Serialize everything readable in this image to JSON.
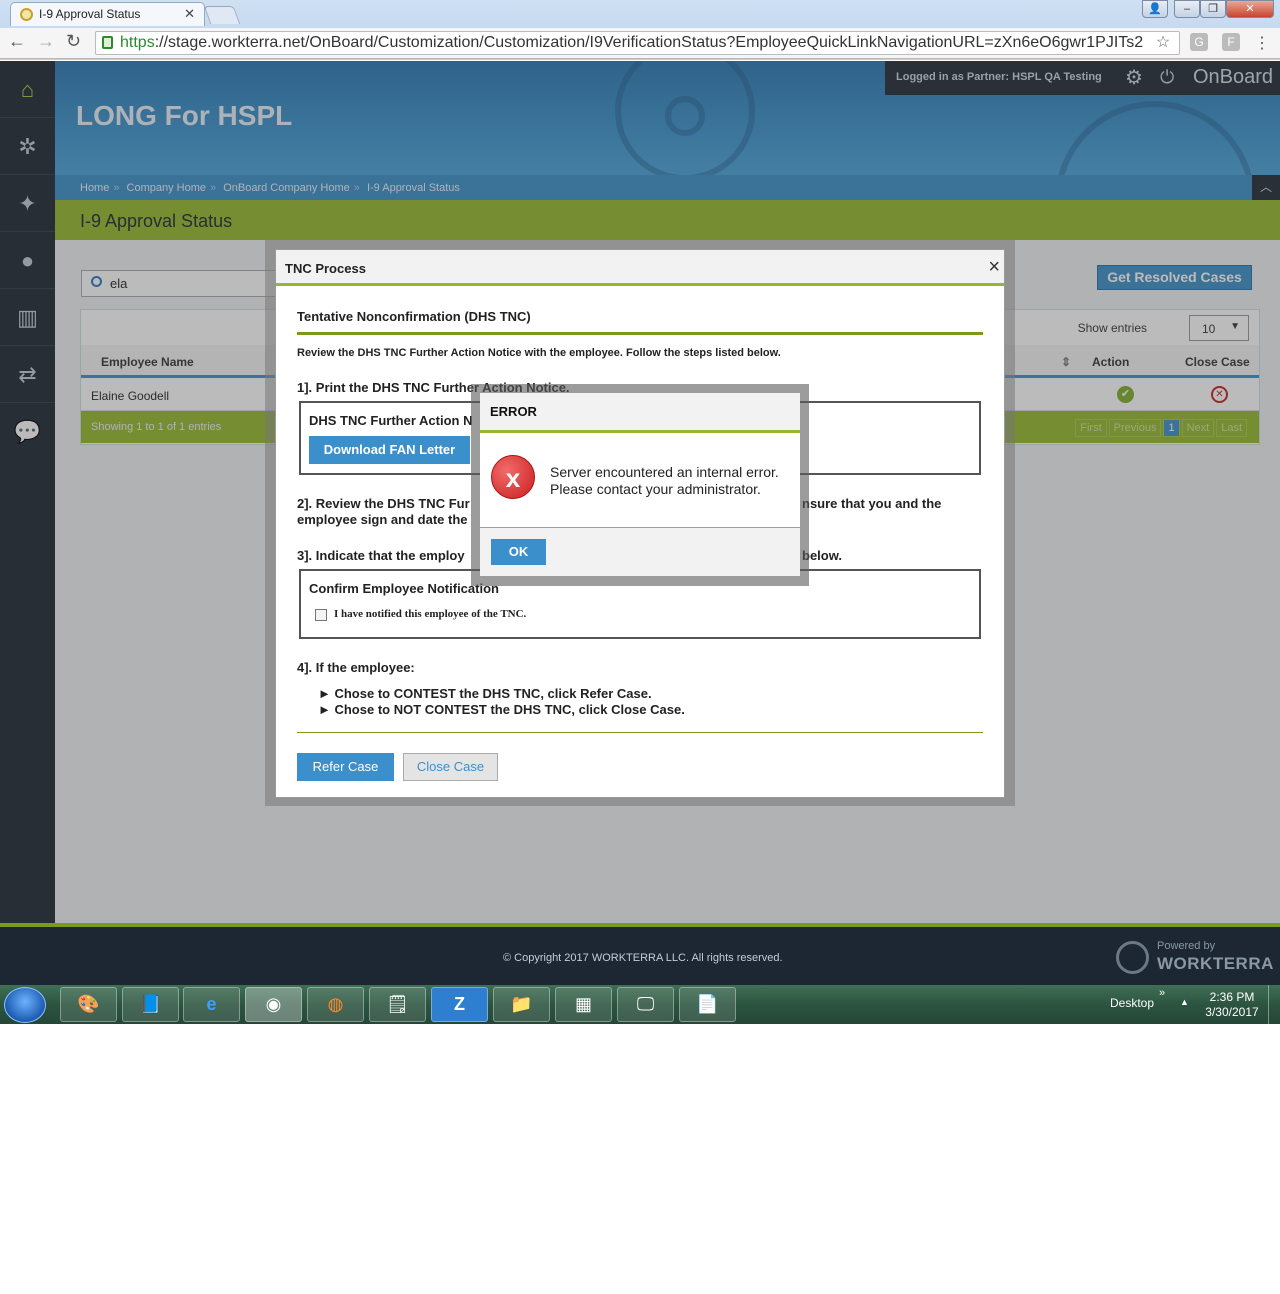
{
  "browser": {
    "tab_title": "I-9 Approval Status",
    "url_https": "https",
    "url_rest": "://stage.workterra.net/OnBoard/Customization/Customization/I9VerificationStatus?EmployeeQuickLinkNavigationURL=zXn6eO6gwr1PJITs2",
    "icons": [
      "back-arrow-icon",
      "forward-arrow-icon",
      "reload-icon",
      "lock-icon",
      "star-icon",
      "menu-icon"
    ]
  },
  "header": {
    "company": "LONG For HSPL",
    "login_label": "Logged in as Partner:",
    "login_user": "HSPL QA Testing",
    "app_name": "OnBoard"
  },
  "breadcrumb": [
    "Home",
    "Company Home",
    "OnBoard Company Home",
    "I-9 Approval Status"
  ],
  "page": {
    "title": "I-9 Approval Status",
    "search_value": "ela",
    "resolved_button": "Get Resolved Cases",
    "show_entries_label": "Show entries",
    "show_entries_value": "10",
    "columns": [
      "Employee Name",
      "Action",
      "Close Case"
    ],
    "row": {
      "employee_name": "Elaine Goodell"
    },
    "footer_info": "Showing 1 to 1 of 1 entries",
    "pager": [
      "First",
      "Previous",
      "1",
      "Next",
      "Last"
    ]
  },
  "tnc_modal": {
    "title": "TNC Process",
    "close": "×",
    "section_title": "Tentative Nonconfirmation (DHS TNC)",
    "intro": "Review the DHS TNC Further Action Notice with the employee. Follow the steps listed below.",
    "step1": "1]. Print the DHS TNC Further Action Notice.",
    "box1_title": "DHS TNC Further Action N",
    "download_button": "Download FAN Letter",
    "step2_line1_a": "2]. Review the DHS TNC Fur",
    "step2_line1_b": "nsure that you and the",
    "step2_line2": "employee sign and date the",
    "step3_a": "3]. Indicate that the employ",
    "step3_b": "below.",
    "box3_title": "Confirm Employee Notification",
    "checkbox_label": "I have notified this employee of the TNC.",
    "step4": "4]. If the employee:",
    "bullet1": "► Chose to CONTEST the DHS TNC, click Refer Case.",
    "bullet2": "► Chose to NOT CONTEST the DHS TNC, click Close Case.",
    "refer_button": "Refer Case",
    "close_button": "Close Case"
  },
  "error_dialog": {
    "title": "ERROR",
    "icon": "x",
    "message_line1": "Server encountered an internal error.",
    "message_line2": "Please contact your administrator.",
    "ok_button": "OK"
  },
  "footer": {
    "copyright": "© Copyright 2017 WORKTERRA LLC. All rights reserved.",
    "powered_by": "Powered by",
    "brand": "WORKTERRA"
  },
  "taskbar": {
    "desktop_label": "Desktop",
    "time": "2:36 PM",
    "date": "3/30/2017"
  },
  "colors": {
    "accent_blue": "#3b8fca",
    "accent_green": "#96b92b",
    "sidebar_dark": "#1c2733",
    "error_red": "#c81f1f"
  }
}
